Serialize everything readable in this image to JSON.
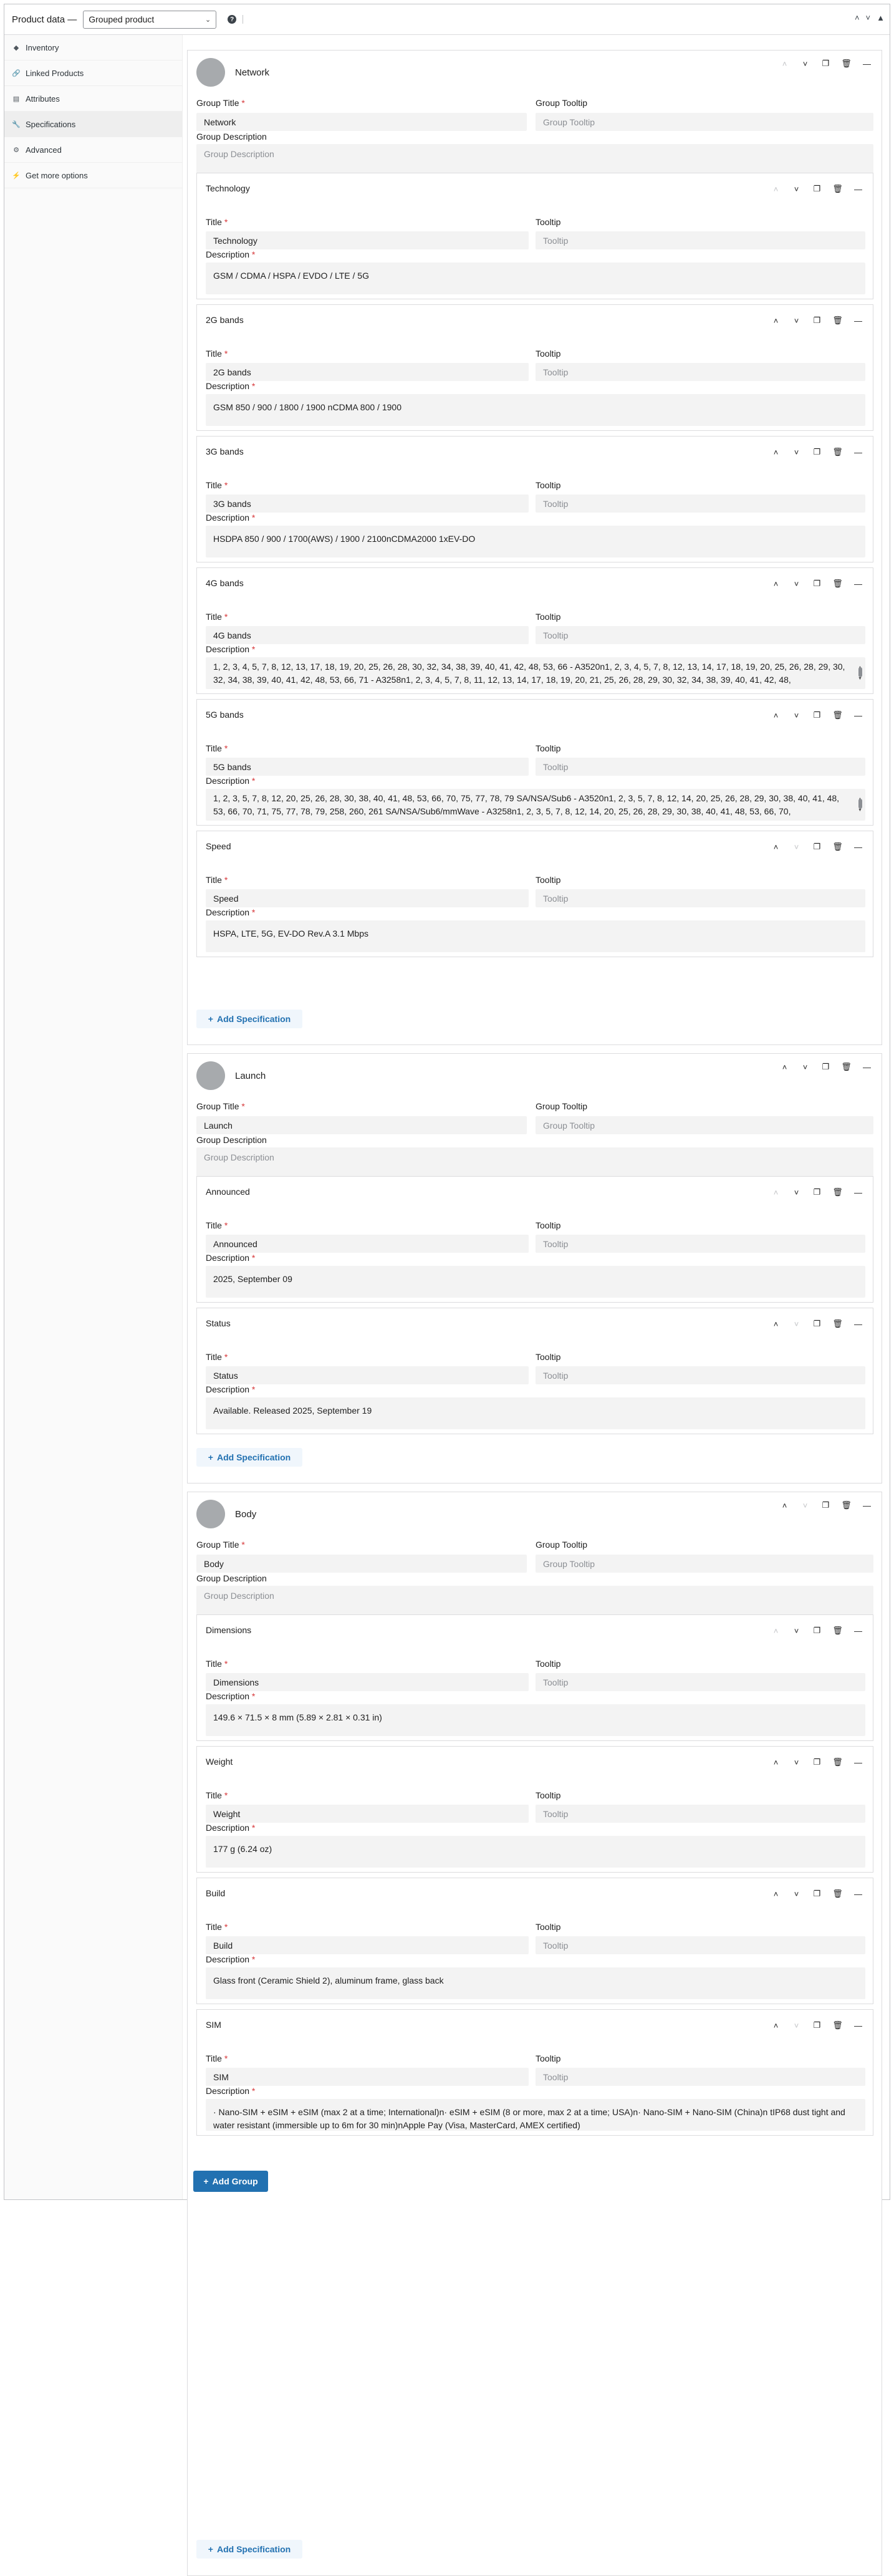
{
  "header": {
    "label": "Product data —",
    "product_type": "Grouped product",
    "help_icon": "question-icon",
    "controls": [
      "chevron-up-icon",
      "chevron-down-icon",
      "triangle-up-icon"
    ]
  },
  "tabs": [
    {
      "label": "Inventory",
      "icon": "diamond-icon"
    },
    {
      "label": "Linked Products",
      "icon": "link-icon"
    },
    {
      "label": "Attributes",
      "icon": "table-icon"
    },
    {
      "label": "Specifications",
      "icon": "wrench-icon",
      "active": true
    },
    {
      "label": "Advanced",
      "icon": "gear-icon"
    },
    {
      "label": "Get more options",
      "icon": "plug-icon"
    }
  ],
  "labels": {
    "group_title": "Group Title",
    "group_tooltip": "Group Tooltip",
    "group_description": "Group Description",
    "title": "Title",
    "tooltip": "Tooltip",
    "description": "Description",
    "required_mark": "*",
    "group_tooltip_placeholder": "Group Tooltip",
    "group_description_placeholder": "Group Description",
    "tooltip_placeholder": "Tooltip",
    "add_specification": "Add Specification",
    "add_group": "Add Group"
  },
  "groups": [
    {
      "name": "Network",
      "title": "Network",
      "specs": [
        {
          "name": "Technology",
          "title": "Technology",
          "description": "GSM / CDMA / HSPA / EVDO / LTE / 5G"
        },
        {
          "name": "2G bands",
          "title": "2G bands",
          "description": "GSM 850 / 900 / 1800 / 1900 nCDMA 800 / 1900"
        },
        {
          "name": "3G bands",
          "title": "3G bands",
          "description": "HSDPA 850 / 900 / 1700(AWS) / 1900 / 2100nCDMA2000 1xEV-DO"
        },
        {
          "name": "4G bands",
          "title": "4G bands",
          "description": "1, 2, 3, 4, 5, 7, 8, 12, 13, 17, 18, 19, 20, 25, 26, 28, 30, 32, 34, 38, 39, 40, 41, 42, 48, 53, 66 - A3520n1, 2, 3, 4, 5, 7, 8, 12, 13, 14, 17, 18, 19, 20, 25, 26, 28, 29, 30, 32, 34, 38, 39, 40, 41, 42, 48, 53, 66, 71 - A3258n1, 2, 3, 4, 5, 7, 8, 11, 12, 13, 14, 17, 18, 19, 20, 21, 25, 26, 28, 29, 30, 32, 34, 38, 39, 40, 41, 42, 48,"
        },
        {
          "name": "5G bands",
          "title": "5G bands",
          "description": "1, 2, 3, 5, 7, 8, 12, 20, 25, 26, 28, 30, 38, 40, 41, 48, 53, 66, 70, 75, 77, 78, 79 SA/NSA/Sub6 - A3520n1, 2, 3, 5, 7, 8, 12, 14, 20, 25, 26, 28, 29, 30, 38, 40, 41, 48, 53, 66, 70, 71, 75, 77, 78, 79, 258, 260, 261 SA/NSA/Sub6/mmWave - A3258n1, 2, 3, 5, 7, 8, 12, 14, 20, 25, 26, 28, 29, 30, 38, 40, 41, 48, 53, 66, 70,"
        },
        {
          "name": "Speed",
          "title": "Speed",
          "description": "HSPA, LTE, 5G, EV-DO Rev.A 3.1 Mbps"
        }
      ]
    },
    {
      "name": "Launch",
      "title": "Launch",
      "specs": [
        {
          "name": "Announced",
          "title": "Announced",
          "description": "2025, September 09"
        },
        {
          "name": "Status",
          "title": "Status",
          "description": "Available. Released 2025, September 19"
        }
      ]
    },
    {
      "name": "Body",
      "title": "Body",
      "specs": [
        {
          "name": "Dimensions",
          "title": "Dimensions",
          "description": "149.6 × 71.5 × 8 mm (5.89 × 2.81 × 0.31 in)"
        },
        {
          "name": "Weight",
          "title": "Weight",
          "description": "177 g (6.24 oz)"
        },
        {
          "name": "Build",
          "title": "Build",
          "description": "Glass front (Ceramic Shield 2), aluminum frame, glass back"
        },
        {
          "name": "SIM",
          "title": "SIM",
          "description": "· Nano-SIM + eSIM + eSIM (max 2 at a time; International)n· eSIM + eSIM (8 or more, max 2 at a time; USA)n· Nano-SIM + Nano-SIM (China)n tIP68 dust tight and water resistant (immersible up to 6m for 30 min)nApple Pay (Visa, MasterCard, AMEX certified)"
        }
      ]
    }
  ]
}
